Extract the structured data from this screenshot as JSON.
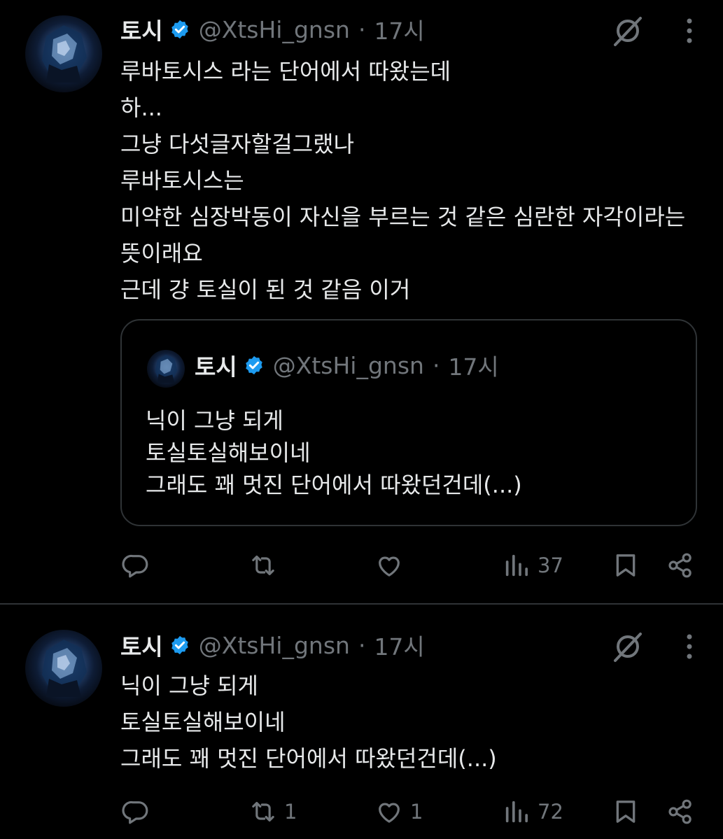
{
  "tweets": [
    {
      "author": {
        "name": "토시",
        "handle": "@XtsHi_gnsn",
        "verified": true
      },
      "separator": "·",
      "time": "17시",
      "lines": [
        "루바토시스 라는 단어에서 따왔는데",
        "하...",
        "그냥 다섯글자할걸그랬나",
        "루바토시스는",
        "미약한 심장박동이 자신을 부르는 것 같은 심란한 자각이라는",
        "뜻이래요",
        "근데 걍 토실이 된 것 같음 이거"
      ],
      "quote": {
        "author": {
          "name": "토시",
          "handle": "@XtsHi_gnsn",
          "verified": true
        },
        "separator": "·",
        "time": "17시",
        "lines": [
          "닉이 그냥 되게",
          "토실토실해보이네",
          "그래도 꽤 멋진 단어에서 따왔던건데(...)"
        ]
      },
      "metrics": {
        "replies": "",
        "reposts": "",
        "likes": "",
        "views": "37"
      }
    },
    {
      "author": {
        "name": "토시",
        "handle": "@XtsHi_gnsn",
        "verified": true
      },
      "separator": "·",
      "time": "17시",
      "lines": [
        "닉이 그냥 되게",
        "토실토실해보이네",
        "그래도 꽤 멋진 단어에서 따왔던건데(...)"
      ],
      "metrics": {
        "replies": "",
        "reposts": "1",
        "likes": "1",
        "views": "72"
      }
    }
  ],
  "icons": {
    "verified": "verified-badge-icon",
    "grok": "grok-icon",
    "more": "more-options-icon",
    "reply": "reply-icon",
    "repost": "repost-icon",
    "like": "like-icon",
    "views": "views-icon",
    "bookmark": "bookmark-icon",
    "share": "share-icon"
  },
  "colors": {
    "background": "#000000",
    "text": "#e7e9ea",
    "secondary": "#71767b",
    "border": "#2f3336",
    "verified": "#1d9bf0"
  }
}
